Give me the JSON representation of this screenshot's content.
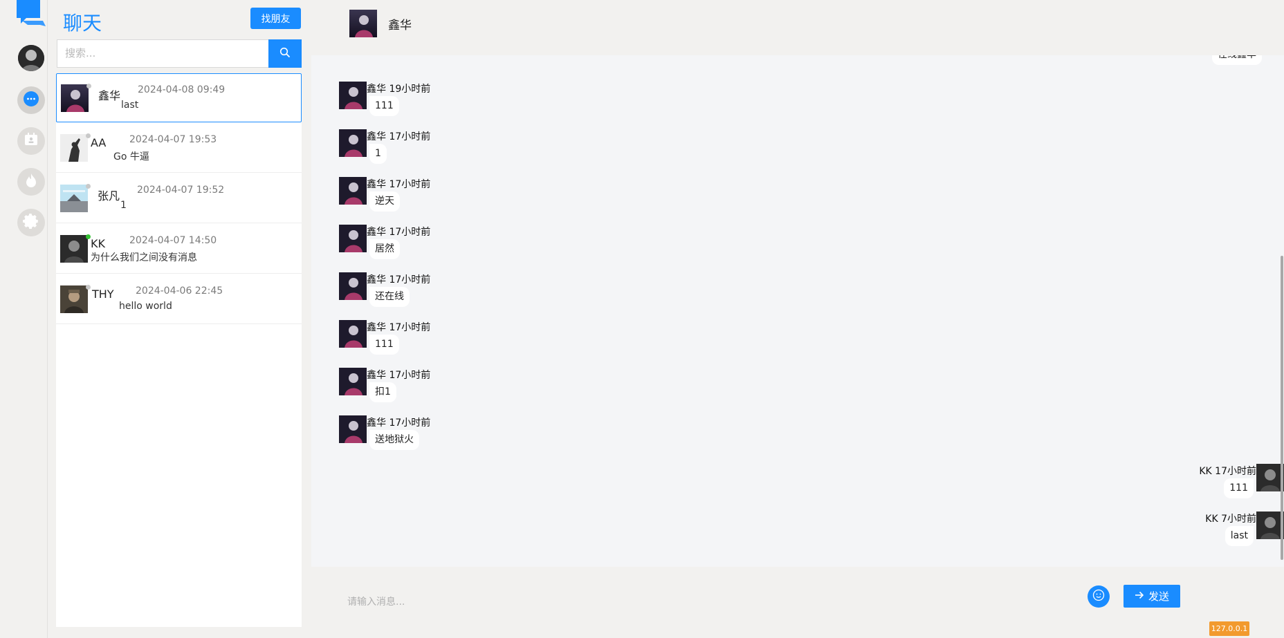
{
  "app": {
    "title": "聊天",
    "find_friends_label": "找朋友",
    "accent_color": "#1a8cff"
  },
  "rail": {
    "items": [
      {
        "icon": "user-avatar"
      },
      {
        "icon": "chat-bubble-icon"
      },
      {
        "icon": "contacts-icon"
      },
      {
        "icon": "fire-icon"
      },
      {
        "icon": "gear-icon"
      }
    ]
  },
  "search": {
    "placeholder": "搜索...",
    "value": ""
  },
  "conversations": [
    {
      "name": "鑫华",
      "time": "2024-04-08 09:49",
      "last": "last",
      "online": false,
      "selected": true
    },
    {
      "name": "AA",
      "time": "2024-04-07 19:53",
      "last": "Go 牛逼",
      "online": false,
      "selected": false
    },
    {
      "name": "张凡",
      "time": "2024-04-07 19:52",
      "last": "1",
      "online": false,
      "selected": false
    },
    {
      "name": "KK",
      "time": "2024-04-07 14:50",
      "last": "为什么我们之间没有消息",
      "online": true,
      "selected": false
    },
    {
      "name": "THY",
      "time": "2024-04-06 22:45",
      "last": "hello world",
      "online": false,
      "selected": false
    }
  ],
  "chat": {
    "peer_name": "鑫华",
    "partial_top_bubble": "在线鑫华",
    "messages": [
      {
        "side": "left",
        "meta": "鑫华 19小时前",
        "text": "111"
      },
      {
        "side": "left",
        "meta": "鑫华 17小时前",
        "text": "1"
      },
      {
        "side": "left",
        "meta": "鑫华 17小时前",
        "text": "逆天"
      },
      {
        "side": "left",
        "meta": "鑫华 17小时前",
        "text": "居然"
      },
      {
        "side": "left",
        "meta": "鑫华 17小时前",
        "text": "还在线"
      },
      {
        "side": "left",
        "meta": "鑫华 17小时前",
        "text": "111"
      },
      {
        "side": "left",
        "meta": "鑫华 17小时前",
        "text": "扣1"
      },
      {
        "side": "left",
        "meta": "鑫华 17小时前",
        "text": "送地狱火"
      },
      {
        "side": "right",
        "meta": "KK 17小时前",
        "text": "111"
      },
      {
        "side": "right",
        "meta": "KK 7小时前",
        "text": "last"
      }
    ],
    "input_placeholder": "请输入消息...",
    "input_value": "",
    "send_label": "发送",
    "ip_badge": "127.0.0.1"
  }
}
